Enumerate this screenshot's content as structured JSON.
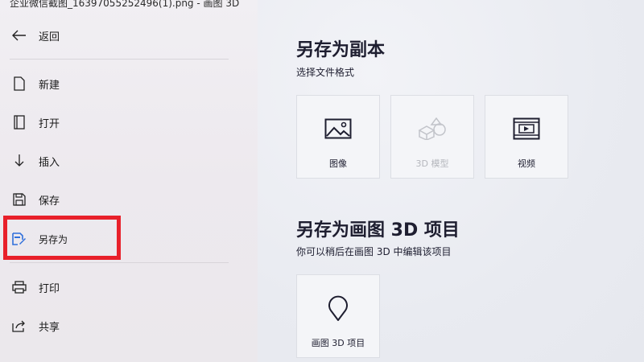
{
  "window": {
    "title": "企业微信截图_16397055252496(1).png - 画图 3D"
  },
  "sidebar": {
    "back_label": "返回",
    "items": [
      {
        "label": "新建",
        "icon": "document-icon"
      },
      {
        "label": "打开",
        "icon": "open-icon"
      },
      {
        "label": "插入",
        "icon": "insert-icon"
      },
      {
        "label": "保存",
        "icon": "save-icon"
      },
      {
        "label": "另存为",
        "icon": "save-as-icon",
        "selected": true
      },
      {
        "label": "打印",
        "icon": "print-icon"
      },
      {
        "label": "共享",
        "icon": "share-icon"
      }
    ]
  },
  "save_copy": {
    "title": "另存为副本",
    "subtitle": "选择文件格式",
    "tiles": [
      {
        "label": "图像",
        "icon": "image-icon",
        "enabled": true
      },
      {
        "label": "3D 模型",
        "icon": "3d-shapes-icon",
        "enabled": false
      },
      {
        "label": "视频",
        "icon": "video-icon",
        "enabled": true
      }
    ]
  },
  "save_project": {
    "title": "另存为画图 3D 项目",
    "subtitle": "你可以稍后在画图 3D 中编辑该项目",
    "tiles": [
      {
        "label": "画图 3D 项目",
        "icon": "paint3d-project-icon",
        "enabled": true
      }
    ]
  },
  "colors": {
    "highlight": "#e8202a",
    "accent": "#2f6fdb",
    "text": "#1e1e30"
  }
}
